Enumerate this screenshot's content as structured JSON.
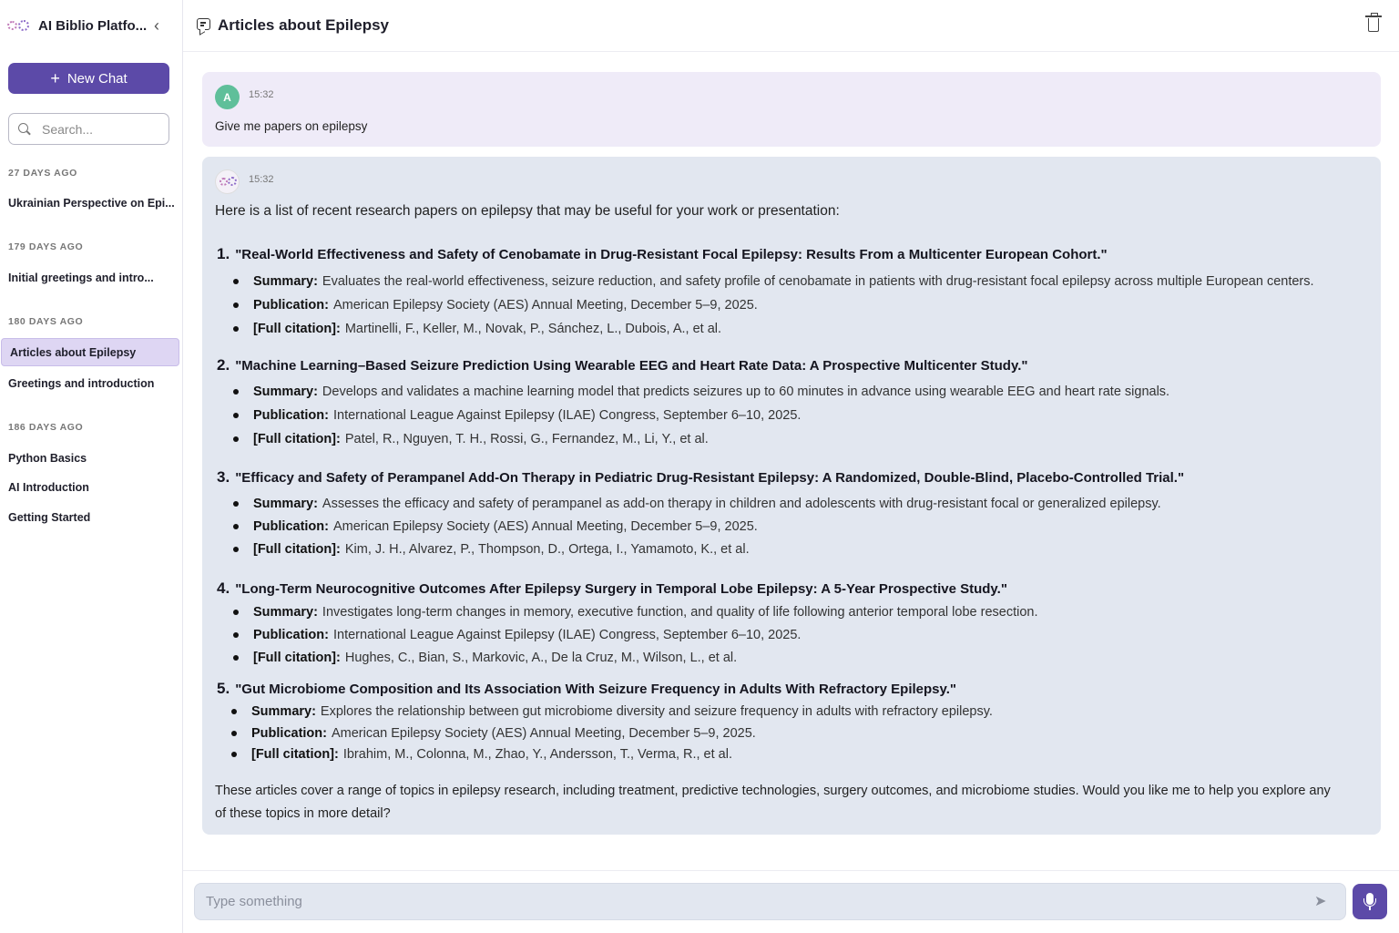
{
  "app": {
    "title": "AI Biblio Platfo..."
  },
  "sidebar": {
    "new_chat_label": "New Chat",
    "search_placeholder": "Search...",
    "groups": [
      {
        "label": "27 DAYS AGO",
        "items": [
          "Ukrainian Perspective on Epi..."
        ]
      },
      {
        "label": "179 DAYS AGO",
        "items": [
          "Initial greetings and intro..."
        ]
      },
      {
        "label": "180 DAYS AGO",
        "items": [
          "Articles about Epilepsy",
          "Greetings and introduction"
        ]
      },
      {
        "label": "186 DAYS AGO",
        "items": [
          "Python Basics",
          "AI Introduction",
          "Getting Started"
        ]
      }
    ],
    "active_item": "Articles about Epilepsy"
  },
  "chat": {
    "title": "Articles about Epilepsy",
    "messages": {
      "user": {
        "avatar_letter": "A",
        "time": "15:32",
        "text": "Give me papers on epilepsy"
      },
      "bot": {
        "time": "15:32",
        "intro": "Here is a list of recent research papers on epilepsy that may be useful for your work or presentation:",
        "papers": [
          {
            "num": "1.",
            "title": "\"Real-World Effectiveness and Safety of Cenobamate in Drug-Resistant Focal Epilepsy: Results From a Multicenter European Cohort.\"",
            "summary": "Evaluates the real-world effectiveness, seizure reduction, and safety profile of cenobamate in patients with drug-resistant focal epilepsy across multiple European centers.",
            "publication": "American Epilepsy Society (AES) Annual Meeting, December 5–9, 2025.",
            "citation": "Martinelli, F., Keller, M., Novak, P., Sánchez, L., Dubois, A., et al."
          },
          {
            "num": "2.",
            "title": "\"Machine Learning–Based Seizure Prediction Using Wearable EEG and Heart Rate Data: A Prospective Multicenter Study.\"",
            "summary": "Develops and validates a machine learning model that predicts seizures up to 60 minutes in advance using wearable EEG and heart rate signals.",
            "publication": "International League Against Epilepsy (ILAE) Congress, September 6–10, 2025.",
            "citation": "Patel, R., Nguyen, T. H., Rossi, G., Fernandez, M., Li, Y., et al."
          },
          {
            "num": "3.",
            "title": "\"Efficacy and Safety of Perampanel Add-On Therapy in Pediatric Drug-Resistant Epilepsy: A Randomized, Double-Blind, Placebo-Controlled Trial.\"",
            "summary": "Assesses the efficacy and safety of perampanel as add-on therapy in children and adolescents with drug-resistant focal or generalized epilepsy.",
            "publication": "American Epilepsy Society (AES) Annual Meeting, December 5–9, 2025.",
            "citation": "Kim, J. H., Alvarez, P., Thompson, D., Ortega, I., Yamamoto, K., et al."
          },
          {
            "num": "4.",
            "title": "\"Long-Term Neurocognitive Outcomes After Epilepsy Surgery in Temporal Lobe Epilepsy: A 5-Year Prospective Study.\"",
            "summary": "Investigates long-term changes in memory, executive function, and quality of life following anterior temporal lobe resection.",
            "publication": "International League Against Epilepsy (ILAE) Congress, September 6–10, 2025.",
            "citation": "Hughes, C., Bian, S., Markovic, A., De la Cruz, M., Wilson, L., et al."
          },
          {
            "num": "5.",
            "title": "\"Gut Microbiome Composition and Its Association With Seizure Frequency in Adults With Refractory Epilepsy.\"",
            "summary": "Explores the relationship between gut microbiome diversity and seizure frequency in adults with refractory epilepsy.",
            "publication": "American Epilepsy Society (AES) Annual Meeting, December 5–9, 2025.",
            "citation": "Ibrahim, M., Colonna, M., Zhao, Y., Andersson, T., Verma, R., et al."
          }
        ],
        "labels": {
          "summary": "Summary:",
          "publication": "Publication:",
          "citation": "[Full citation]:"
        },
        "outro": "These articles cover a range of topics in epilepsy research, including treatment, predictive technologies, surgery outcomes, and microbiome studies. Would you like me to help you explore any of these topics in more detail?"
      }
    }
  },
  "composer": {
    "placeholder": "Type something"
  },
  "colors": {
    "accent": "#5c4aa8",
    "active_bg": "#ded6f3",
    "bot_bg": "#e2e7f0",
    "user_bg": "#efebf8",
    "avatar_user": "#5fbf9a"
  },
  "icons": [
    "logo-icon",
    "chevron-left-icon",
    "plus-icon",
    "search-icon",
    "chat-bubble-icon",
    "trash-icon",
    "send-icon",
    "microphone-icon"
  ]
}
